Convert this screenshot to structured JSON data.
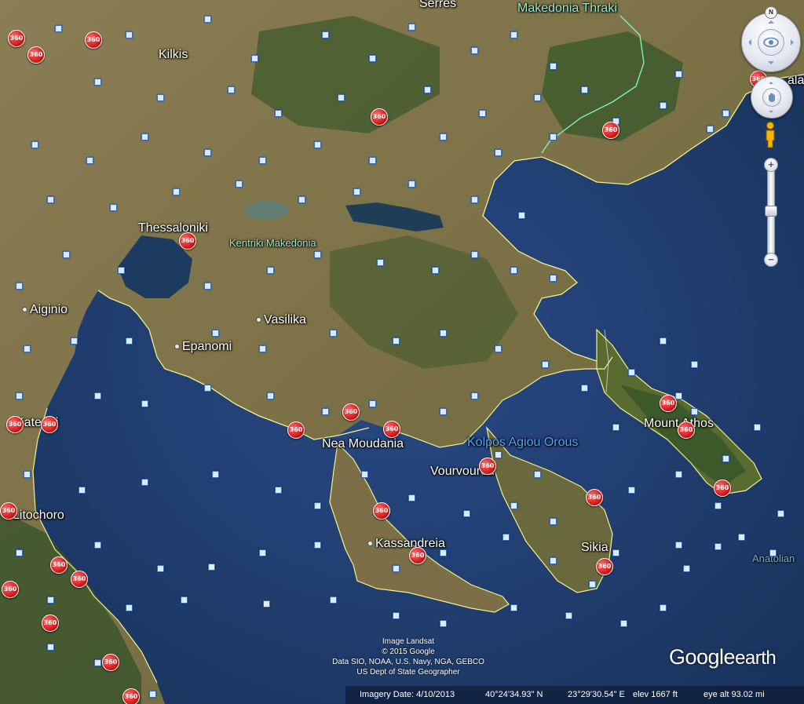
{
  "places": [
    {
      "id": "serres",
      "label": "Serres"
    },
    {
      "id": "makedonia-thraki",
      "label": "Makedonia Thraki"
    },
    {
      "id": "kilkis",
      "label": "Kilkis"
    },
    {
      "id": "kavala",
      "label": "ala"
    },
    {
      "id": "thessaloniki",
      "label": "Thessaloniki"
    },
    {
      "id": "kentriki-makedonia",
      "label": "Kentriki Makedonia"
    },
    {
      "id": "aiginio",
      "label": "Aiginio"
    },
    {
      "id": "vasilika",
      "label": "Vasilika"
    },
    {
      "id": "epanomi",
      "label": "Epanomi"
    },
    {
      "id": "katerini",
      "label": "Katerini"
    },
    {
      "id": "nea-moudania",
      "label": "Nea Moudania"
    },
    {
      "id": "kolpos-agiou-orous",
      "label": "Kolpos Agiou Orous"
    },
    {
      "id": "vourvourou",
      "label": "Vourvourou"
    },
    {
      "id": "mount-athos",
      "label": "Mount Athos"
    },
    {
      "id": "litochoro",
      "label": "Litochoro"
    },
    {
      "id": "kassandreia",
      "label": "Kassandreia"
    },
    {
      "id": "sikia",
      "label": "Sikia"
    },
    {
      "id": "anatolian",
      "label": "Anatolian"
    }
  ],
  "panorama_icon_label": "360",
  "credits": {
    "line1": "Image Landsat",
    "line2": "© 2015 Google",
    "line3": "Data SIO, NOAA, U.S. Navy, NGA, GEBCO",
    "line4": "US Dept of State Geographer"
  },
  "logo": {
    "google": "Google",
    "earth": "earth"
  },
  "status": {
    "imagery_date": "Imagery Date: 4/10/2013",
    "lat": "40°24'34.93\" N",
    "lon": "23°29'30.54\" E",
    "elev": "elev   1667 ft",
    "eye_alt": "eye alt   93.02 mi"
  },
  "nav": {
    "north_label": "N",
    "zoom_in_label": "+",
    "zoom_out_label": "−",
    "zoom_level": 0.45
  },
  "colors": {
    "sea": "#1c3560",
    "land": "#8a7d52",
    "forest": "#3d5a2c",
    "border": "#f2f08a",
    "region_border": "#7ef0c0",
    "pano_red": "#d01515",
    "gulf_label": "#4fa6ff"
  },
  "icons": {
    "photo": "photo-icon",
    "panorama": "panorama-360-icon",
    "pegman": "pegman-icon",
    "look": "look-eye-icon",
    "move": "move-hand-icon"
  }
}
